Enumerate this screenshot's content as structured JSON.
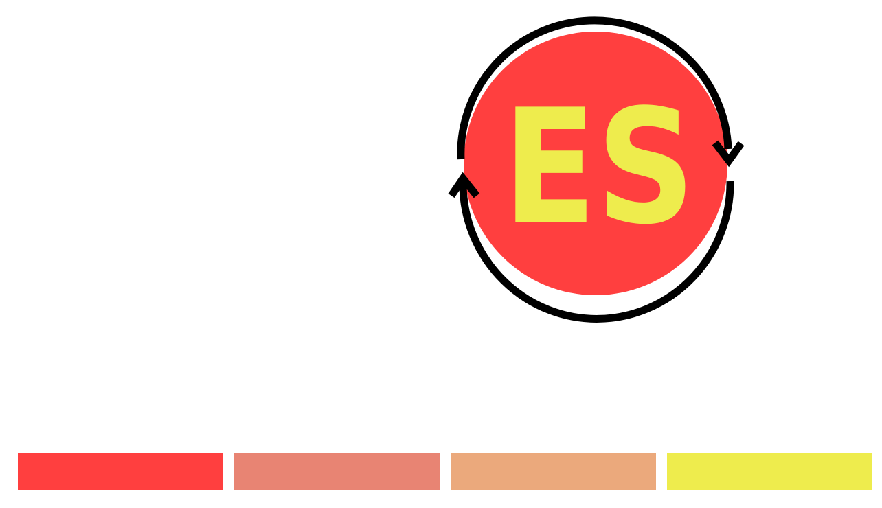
{
  "logo": {
    "text": "ES",
    "circle_color": "#FF3F3F",
    "text_color": "#EEEC4D",
    "ring_color": "#000000",
    "icon": "refresh-cycle-arrows-icon"
  },
  "palette": [
    {
      "name": "red",
      "color": "#FF3F3F"
    },
    {
      "name": "salmon",
      "color": "#E88473"
    },
    {
      "name": "peach",
      "color": "#EBA97C"
    },
    {
      "name": "yellow",
      "color": "#EEEC4D"
    }
  ]
}
